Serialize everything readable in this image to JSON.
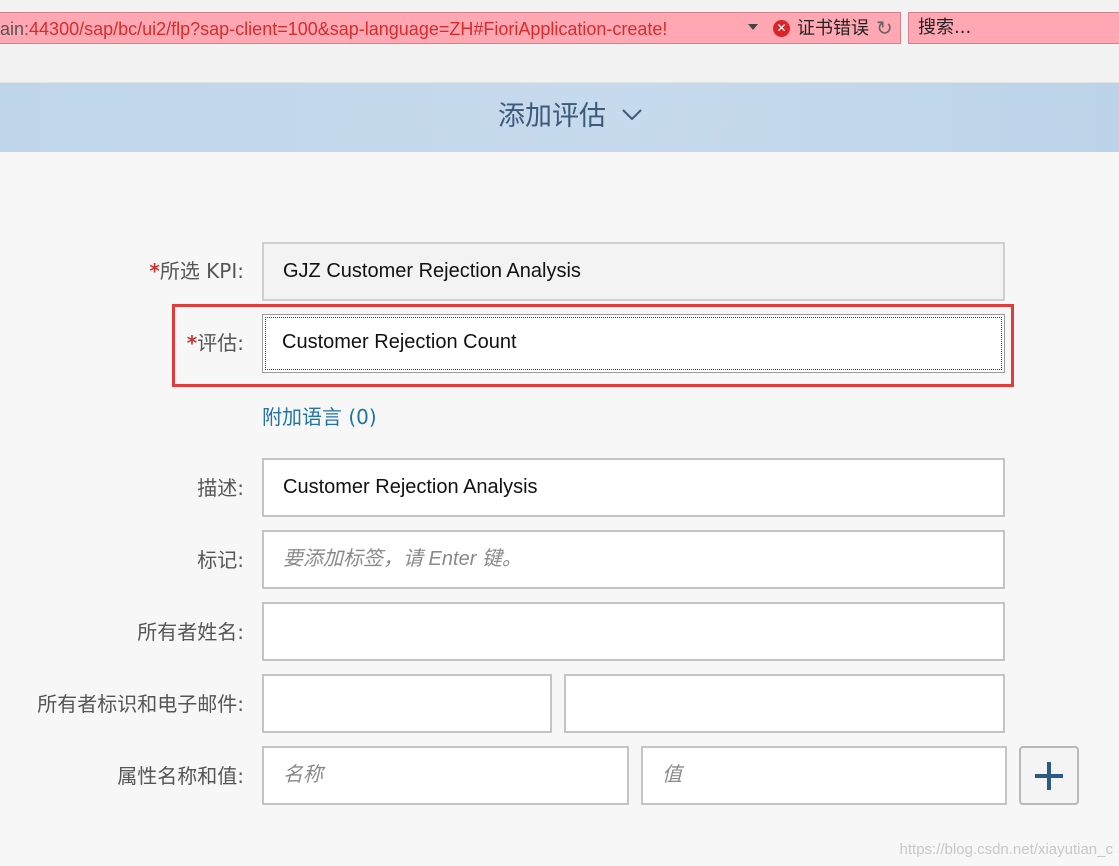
{
  "browser": {
    "url_host": "ain",
    "url_path": ":44300/sap/bc/ui2/flp?sap-client=100&sap-language=ZH#FioriApplication-create!",
    "cert_error": "证书错误",
    "search_placeholder": "搜索..."
  },
  "header": {
    "title": "添加评估"
  },
  "form": {
    "kpi": {
      "required": "*",
      "label": "所选 KPI:",
      "value": "GJZ Customer Rejection Analysis"
    },
    "evaluation": {
      "required": "*",
      "label": "评估:",
      "value": "Customer Rejection Count"
    },
    "add_language_link": "附加语言 (0)",
    "description": {
      "label": "描述:",
      "value": "Customer Rejection Analysis"
    },
    "tags": {
      "label": "标记:",
      "placeholder": "要添加标签，请 Enter 键。"
    },
    "owner_name": {
      "label": "所有者姓名:",
      "value": ""
    },
    "owner_id_email": {
      "label": "所有者标识和电子邮件:",
      "id_value": "",
      "email_value": ""
    },
    "attributes": {
      "label": "属性名称和值:",
      "name_placeholder": "名称",
      "value_placeholder": "值"
    }
  },
  "watermark": "https://blog.csdn.net/xiayutian_c",
  "colors": {
    "accent": "#2373a6",
    "highlight": "#e03c3c",
    "header_bg": "#c7daed"
  }
}
